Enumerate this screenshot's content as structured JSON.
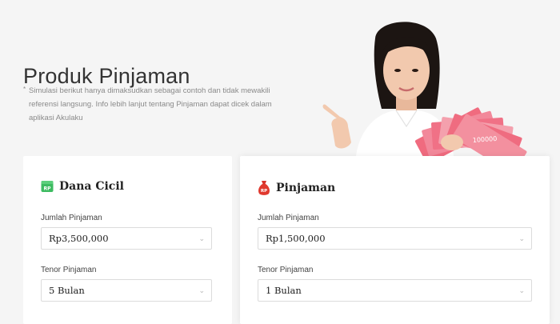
{
  "header": {
    "title": "Produk Pinjaman",
    "disclaimer_star": "*",
    "disclaimer": "Simulasi berikut hanya dimaksudkan sebagai contoh dan tidak mewakili referensi langsung. Info lebih lanjut tentang Pinjaman dapat dicek dalam aplikasi Akulaku"
  },
  "hero": {
    "banknote_label": "100000"
  },
  "cards": [
    {
      "title": "Dana Cicil",
      "icon": "rp-wallet-icon",
      "icon_text": "RP",
      "icon_color": "#3dbb61",
      "amount_label": "Jumlah Pinjaman",
      "amount_value": "Rp3,500,000",
      "tenor_label": "Tenor Pinjaman",
      "tenor_value": "5 Bulan"
    },
    {
      "title": "Pinjaman",
      "icon": "money-bag-icon",
      "icon_text": "RP",
      "icon_color": "#e0392e",
      "amount_label": "Jumlah Pinjaman",
      "amount_value": "Rp1,500,000",
      "tenor_label": "Tenor Pinjaman",
      "tenor_value": "1 Bulan"
    }
  ]
}
